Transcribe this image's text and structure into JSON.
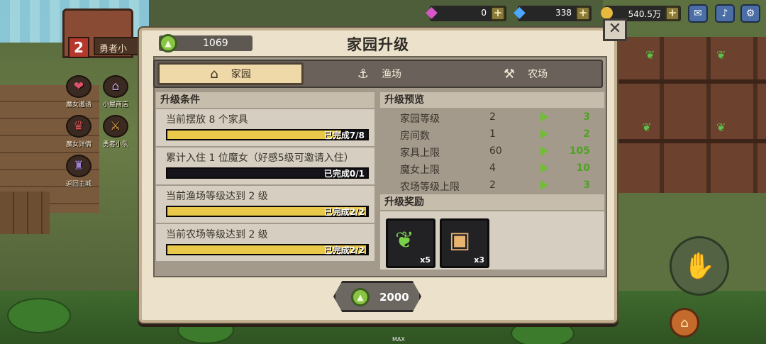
{
  "background": {
    "house_level": "2",
    "house_tag": "勇者小",
    "side_buttons": [
      {
        "label": "魔女邀请",
        "icon": "heart-letter-icon"
      },
      {
        "label": "小屋商店",
        "icon": "shop-icon"
      },
      {
        "label": "魔女详情",
        "icon": "witch-icon"
      },
      {
        "label": "勇者小队",
        "icon": "knight-icon"
      },
      {
        "label": "返回主城",
        "icon": "castle-icon"
      }
    ],
    "max_label": "MAX"
  },
  "resources": [
    {
      "name": "pink-gem",
      "value": "0",
      "color": "#d655c9"
    },
    {
      "name": "blue-gem",
      "value": "338",
      "color": "#4aa8ff"
    },
    {
      "name": "gold",
      "value": "540.5万",
      "color": "#e7b93c"
    }
  ],
  "dialog": {
    "title": "家园升级",
    "current_points": "1069",
    "tabs": [
      {
        "label": "家园",
        "icon": "house-icon",
        "active": true
      },
      {
        "label": "渔场",
        "icon": "fishing-hook-icon",
        "active": false
      },
      {
        "label": "农场",
        "icon": "shovel-icon",
        "active": false
      }
    ],
    "conditions_header": "升级条件",
    "conditions": [
      {
        "text": "当前摆放 8 个家具",
        "progress_text": "已完成7/8",
        "progress": 0.875
      },
      {
        "text": "累计入住 1 位魔女（好感5级可邀请入住）",
        "progress_text": "已完成0/1",
        "progress": 0
      },
      {
        "text": "当前渔场等级达到 2 级",
        "progress_text": "已完成2/2",
        "progress": 1
      },
      {
        "text": "当前农场等级达到 2 级",
        "progress_text": "已完成2/2",
        "progress": 1
      }
    ],
    "preview_header": "升级预览",
    "preview": [
      {
        "label": "家园等级",
        "current": "2",
        "next": "3"
      },
      {
        "label": "房间数",
        "current": "1",
        "next": "2"
      },
      {
        "label": "家具上限",
        "current": "60",
        "next": "105"
      },
      {
        "label": "魔女上限",
        "current": "4",
        "next": "10"
      },
      {
        "label": "农场等级上限",
        "current": "2",
        "next": "3"
      }
    ],
    "rewards_header": "升级奖励",
    "rewards": [
      {
        "icon": "sprout-seed-icon",
        "count": "x5"
      },
      {
        "icon": "chest-blueprint-icon",
        "count": "x3"
      }
    ],
    "upgrade_cost": "2000"
  },
  "colors": {
    "progress_fill": "#e9c84a",
    "progress_empty": "#17131a",
    "next_value": "#4ea323",
    "arrow": "#6fbe34"
  }
}
